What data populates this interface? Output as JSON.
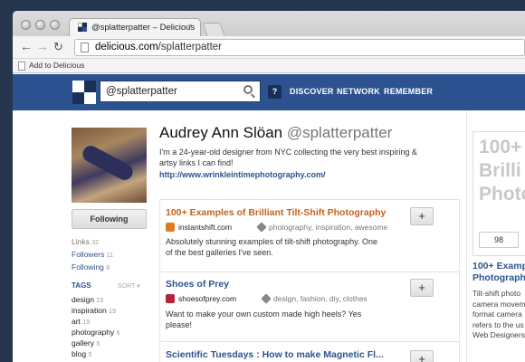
{
  "browser": {
    "tab_title": "@splatterpatter – Delicious",
    "tab_close": "×",
    "url_domain": "delicious.com",
    "url_path": "/splatterpatter",
    "bookmark": "Add to Delicious"
  },
  "header": {
    "search_value": "@splatterpatter",
    "help": "?",
    "nav": [
      "DISCOVER",
      "NETWORK",
      "REMEMBER"
    ],
    "colors": {
      "bar": "#2d5290",
      "logo": [
        "#ffffff",
        "#1a2f57",
        "#1a2f57",
        "#ffffff"
      ]
    }
  },
  "profile": {
    "name": "Audrey Ann Slöan",
    "handle": "@splatterpatter",
    "bio": "I'm a 24-year-old designer from NYC collecting the very best inspiring & artsy links I can find!",
    "url": "http://www.wrinkleintimephotography.com/",
    "follow_label": "Following",
    "stats": [
      {
        "label": "Links",
        "count": "32"
      },
      {
        "label": "Followers",
        "count": "11"
      },
      {
        "label": "Following",
        "count": "8"
      }
    ],
    "tags_label": "TAGS",
    "sort_label": "SORT ▾",
    "tags": [
      {
        "name": "design",
        "count": "23"
      },
      {
        "name": "inspiration",
        "count": "19"
      },
      {
        "name": "art",
        "count": "19"
      },
      {
        "name": "photography",
        "count": "6"
      },
      {
        "name": "gallery",
        "count": "5"
      },
      {
        "name": "blog",
        "count": "5"
      }
    ]
  },
  "links": [
    {
      "title": "100+ Examples of Brilliant Tilt-Shift Photography",
      "domain": "instantshift.com",
      "tags": "photography, inspiration, awesome",
      "desc": "Absolutely stunning examples of tilt-shift photography. One of the best galleries I've seen.",
      "add": "+"
    },
    {
      "title": "Shoes of Prey",
      "domain": "shoesofprey.com",
      "tags": "design, fashion, diy, clothes",
      "desc": "Want to make your own custom made high heels? Yes please!",
      "add": "+"
    },
    {
      "title": "Scientific Tuesdays : How to make Magnetic Fl...",
      "add": "+"
    }
  ],
  "sidebar_right": {
    "promo_lines": [
      "100+",
      "Brilli",
      "Photo"
    ],
    "promo_count": "98",
    "title_lines": [
      "100+ Exampl",
      "Photograph"
    ],
    "desc_lines": [
      "Tilt-shift photo",
      "camera movem",
      "format camera",
      "refers to the us",
      "Web Designers"
    ]
  }
}
